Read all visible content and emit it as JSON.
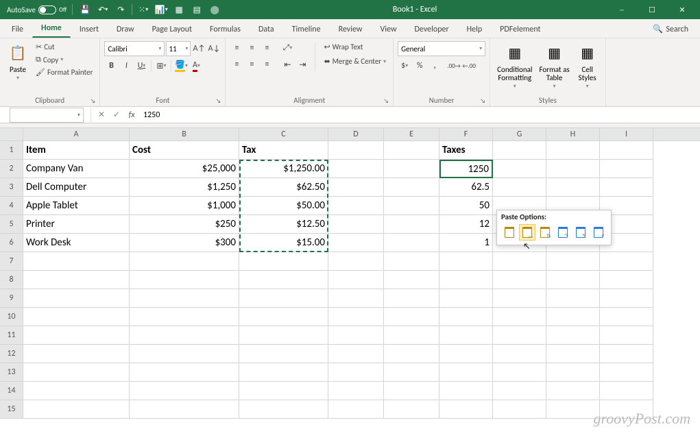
{
  "titlebar": {
    "autosave_label": "AutoSave",
    "autosave_state": "Off",
    "title": "Book1 - Excel"
  },
  "tabs": [
    "File",
    "Home",
    "Insert",
    "Draw",
    "Page Layout",
    "Formulas",
    "Data",
    "Timeline",
    "Review",
    "View",
    "Developer",
    "Help",
    "PDFelement"
  ],
  "active_tab": "Home",
  "tabs_right": {
    "search_label": "Search"
  },
  "ribbon": {
    "clipboard": {
      "label": "Clipboard",
      "paste": "Paste",
      "cut": "Cut",
      "copy": "Copy",
      "fmtpainter": "Format Painter"
    },
    "font": {
      "label": "Font",
      "name": "Calibri",
      "size": "11"
    },
    "alignment": {
      "label": "Alignment",
      "wrap": "Wrap Text",
      "merge": "Merge & Center"
    },
    "number": {
      "label": "Number",
      "format": "General"
    },
    "styles": {
      "label": "Styles",
      "cond": "Conditional\nFormatting",
      "table": "Format as\nTable",
      "cell": "Cell\nStyles"
    }
  },
  "formula_bar": {
    "name_box": "",
    "value": "1250"
  },
  "columns": [
    "A",
    "B",
    "C",
    "D",
    "E",
    "F",
    "G",
    "H",
    "I"
  ],
  "rows": 15,
  "data": {
    "headers": {
      "A": "Item",
      "B": "Cost",
      "C": "Tax",
      "F": "Taxes"
    },
    "items": [
      {
        "item": "Company Van",
        "cost": "$25,000",
        "tax": "$1,250.00",
        "taxes": "1250"
      },
      {
        "item": "Dell Computer",
        "cost": "$1,250",
        "tax": "$62.50",
        "taxes": "62.5"
      },
      {
        "item": "Apple Tablet",
        "cost": "$1,000",
        "tax": "$50.00",
        "taxes": "50"
      },
      {
        "item": "Printer",
        "cost": "$250",
        "tax": "$12.50",
        "taxes": "12"
      },
      {
        "item": "Work Desk",
        "cost": "$300",
        "tax": "$15.00",
        "taxes": "1"
      }
    ]
  },
  "paste_popup": {
    "title": "Paste Options:"
  },
  "watermark": "groovyPost.com"
}
